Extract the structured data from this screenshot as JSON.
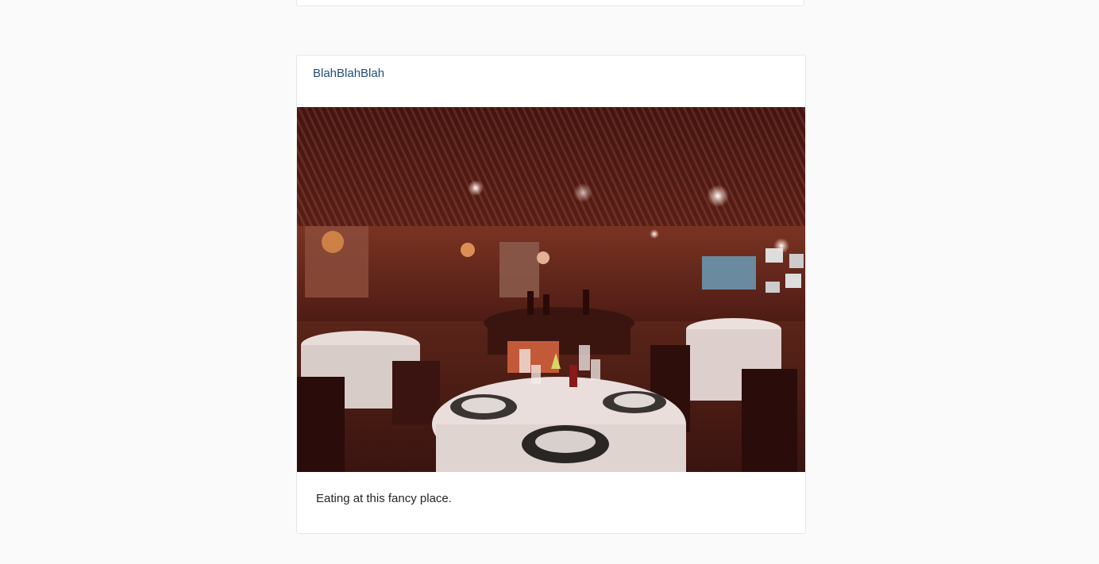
{
  "post": {
    "username": "BlahBlahBlah",
    "caption": "Eating at this fancy place.",
    "image_alt": "restaurant dining room"
  },
  "colors": {
    "background": "#fafafa",
    "card": "#ffffff",
    "border": "#e6e6e6",
    "username": "#1f4e7a",
    "text": "#262626"
  }
}
